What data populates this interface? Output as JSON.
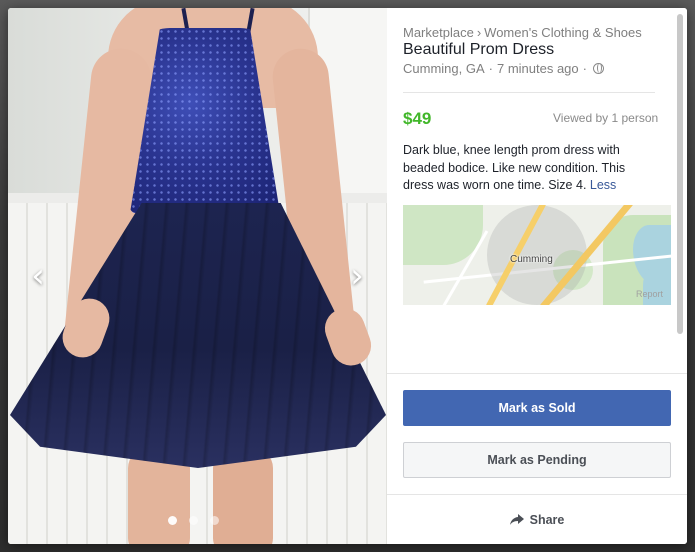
{
  "breadcrumb": {
    "root": "Marketplace",
    "separator": "›",
    "category": "Women's Clothing & Shoes"
  },
  "listing": {
    "title": "Beautiful Prom Dress",
    "location": "Cumming, GA",
    "meta_separator": "·",
    "posted": "7 minutes ago",
    "price": "$49",
    "viewed": "Viewed by 1 person",
    "description": "Dark blue, knee length prom dress with beaded bodice. Like new condition. This dress was worn one time. Size 4.",
    "less_label": "Less"
  },
  "map": {
    "label": "Cumming",
    "report_label": "Report"
  },
  "photo": {
    "prev_glyph": "‹",
    "next_glyph": "›",
    "dots_count": 3,
    "active_dot": 0
  },
  "actions": {
    "mark_sold": "Mark as Sold",
    "mark_pending": "Mark as Pending",
    "share": "Share"
  },
  "colors": {
    "price": "#42b72a",
    "primary_button": "#4267b2",
    "link": "#385898"
  },
  "icons": [
    "globe-icon",
    "share-arrow-icon",
    "chevron-left-icon",
    "chevron-right-icon"
  ]
}
